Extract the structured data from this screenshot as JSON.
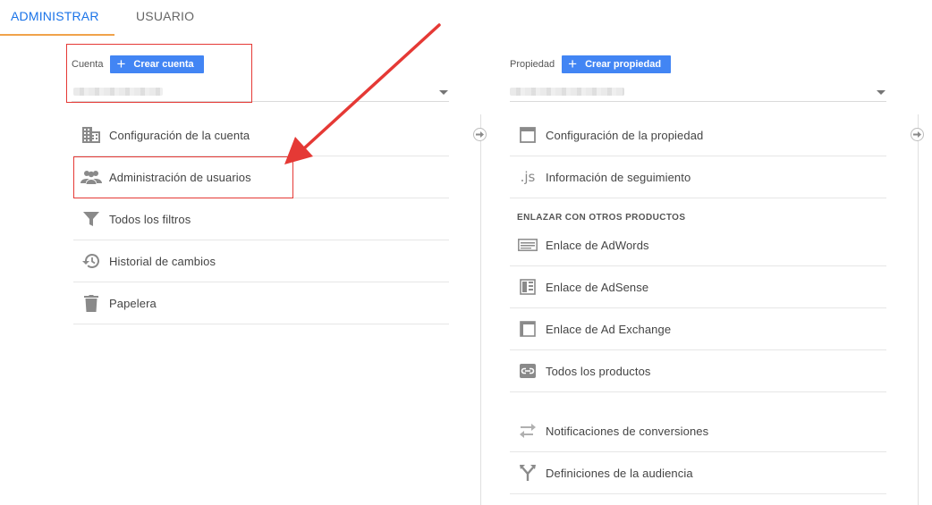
{
  "tabs": [
    {
      "label": "ADMINISTRAR",
      "active": true
    },
    {
      "label": "USUARIO",
      "active": false
    }
  ],
  "account": {
    "label": "Cuenta",
    "create_label": "Crear cuenta",
    "menu": [
      {
        "label": "Configuración de la cuenta",
        "icon": "building-icon"
      },
      {
        "label": "Administración de usuarios",
        "icon": "people-icon"
      },
      {
        "label": "Todos los filtros",
        "icon": "filter-icon"
      },
      {
        "label": "Historial de cambios",
        "icon": "history-icon"
      },
      {
        "label": "Papelera",
        "icon": "trash-icon"
      }
    ]
  },
  "property": {
    "label": "Propiedad",
    "create_label": "Crear propiedad",
    "menu_top": [
      {
        "label": "Configuración de la propiedad",
        "icon": "window-icon"
      },
      {
        "label": "Información de seguimiento",
        "icon": "js-icon",
        "icon_text": ".js"
      }
    ],
    "section_label": "ENLAZAR CON OTROS PRODUCTOS",
    "menu_links": [
      {
        "label": "Enlace de AdWords",
        "icon": "adwords-icon"
      },
      {
        "label": "Enlace de AdSense",
        "icon": "adsense-icon"
      },
      {
        "label": "Enlace de Ad Exchange",
        "icon": "adexchange-icon"
      },
      {
        "label": "Todos los productos",
        "icon": "link-icon"
      }
    ],
    "menu_bottom": [
      {
        "label": "Notificaciones de conversiones",
        "icon": "swap-icon"
      },
      {
        "label": "Definiciones de la audiencia",
        "icon": "fork-icon"
      }
    ]
  },
  "colors": {
    "accent": "#1a73e8",
    "button": "#4285f4",
    "tab_underline": "#f0a24a",
    "annotation": "#e53935"
  }
}
